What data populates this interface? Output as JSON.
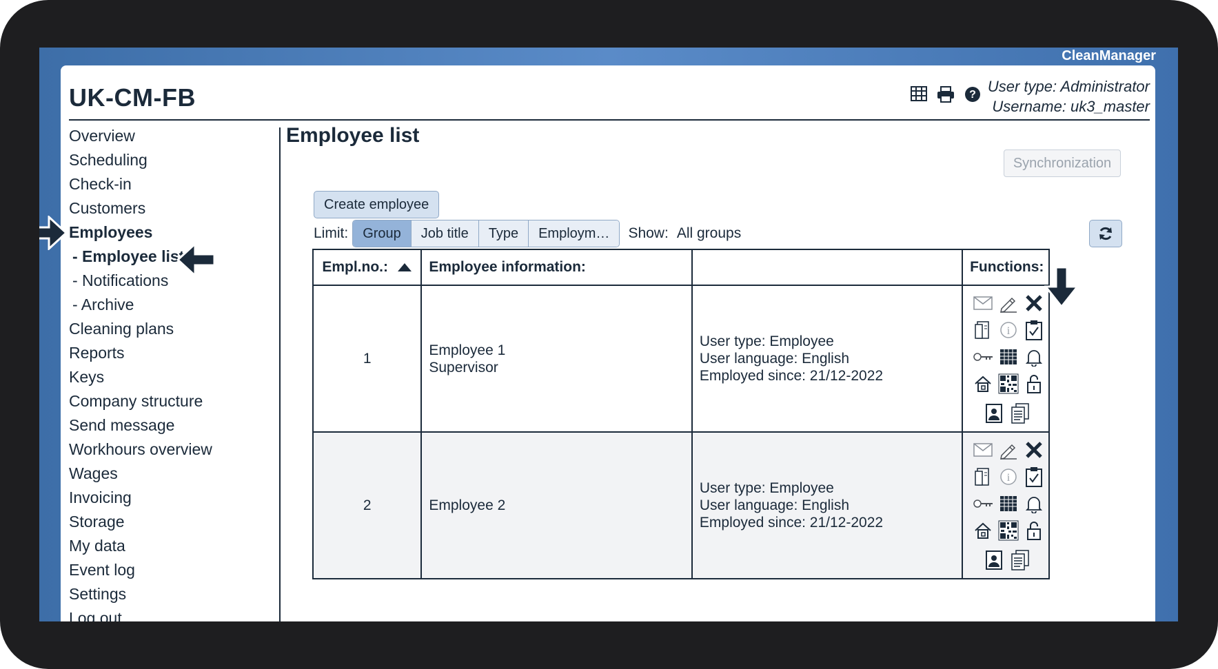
{
  "app": {
    "brand": "CleanManager",
    "title": "UK-CM-FB"
  },
  "header": {
    "user_type": "User type: Administrator",
    "username": "Username: uk3_master",
    "icons": [
      "table-icon",
      "print-icon",
      "help-icon"
    ]
  },
  "sidebar": {
    "items": [
      {
        "label": "Overview"
      },
      {
        "label": "Scheduling"
      },
      {
        "label": "Check-in"
      },
      {
        "label": "Customers"
      },
      {
        "label": "Employees",
        "active": true
      },
      {
        "label": "- Employee list",
        "active": true,
        "sub": true
      },
      {
        "label": "- Notifications",
        "sub": true
      },
      {
        "label": "- Archive",
        "sub": true
      },
      {
        "label": "Cleaning plans"
      },
      {
        "label": "Reports"
      },
      {
        "label": "Keys"
      },
      {
        "label": "Company structure"
      },
      {
        "label": "Send message"
      },
      {
        "label": "Workhours overview"
      },
      {
        "label": "Wages"
      },
      {
        "label": "Invoicing"
      },
      {
        "label": "Storage"
      },
      {
        "label": "My data"
      },
      {
        "label": "Event log"
      },
      {
        "label": "Settings"
      },
      {
        "label": "Log out"
      }
    ]
  },
  "main": {
    "title": "Employee list",
    "sync_label": "Synchronization",
    "create_label": "Create employee",
    "limit_label": "Limit:",
    "limit_options": [
      "Group",
      "Job title",
      "Type",
      "Employm…"
    ],
    "limit_selected": "Group",
    "show_label": "Show:",
    "show_value": "All groups",
    "table": {
      "headers": [
        "Empl.no.:",
        "Employee information:",
        "",
        "Functions:"
      ],
      "rows": [
        {
          "no": "1",
          "name": "Employee 1",
          "role": "Supervisor",
          "user_type": "User type: Employee",
          "language": "User language: English",
          "employed": "Employed since: 21/12-2022"
        },
        {
          "no": "2",
          "name": "Employee 2",
          "role": "",
          "user_type": "User type: Employee",
          "language": "User language: English",
          "employed": "Employed since: 21/12-2022"
        }
      ],
      "function_icons": [
        "mail-icon",
        "edit-pencil-icon",
        "delete-x-icon",
        "document-icon",
        "info-icon",
        "clipboard-check-icon",
        "key-icon",
        "calendar-grid-icon",
        "bell-icon",
        "home-icon",
        "qr-code-icon",
        "unlock-icon",
        "id-card-icon",
        "copy-documents-icon"
      ]
    }
  },
  "colors": {
    "accent": "#1b2a3a",
    "frame": "#4a7cbd",
    "selected_segment": "#94b3d9",
    "button_bg": "#d4e1f0"
  }
}
